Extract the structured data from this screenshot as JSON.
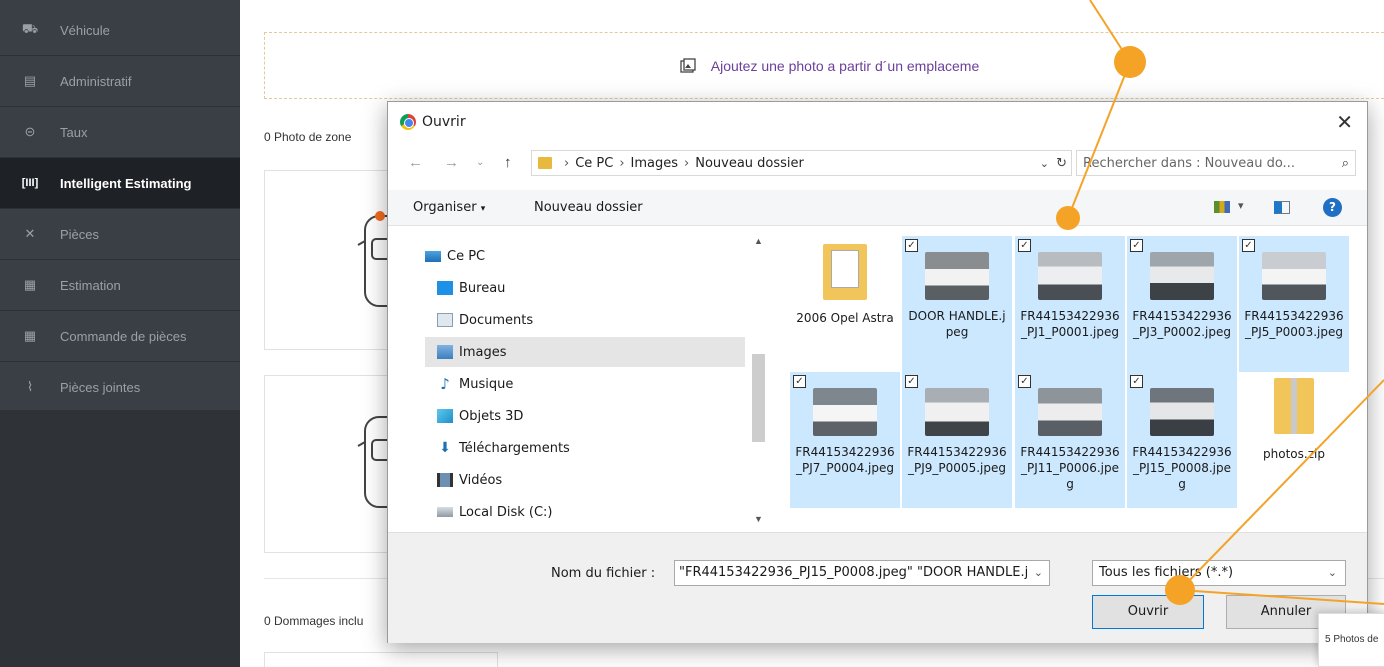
{
  "sidebar": {
    "items": [
      {
        "label": "Véhicule",
        "icon": "car-icon"
      },
      {
        "label": "Administratif",
        "icon": "document-icon"
      },
      {
        "label": "Taux",
        "icon": "tag-icon"
      },
      {
        "label": "Intelligent Estimating",
        "icon": "intelligent-icon",
        "active": true
      },
      {
        "label": "Pièces",
        "icon": "tools-icon"
      },
      {
        "label": "Estimation",
        "icon": "calculator-icon"
      },
      {
        "label": "Commande de pièces",
        "icon": "order-icon"
      },
      {
        "label": "Pièces jointes",
        "icon": "paperclip-icon"
      }
    ]
  },
  "main": {
    "upload_text": "Ajoutez une photo a partir d´un emplaceme",
    "zone_label": "0 Photo de zone",
    "damage_label": "0 Dommages inclu",
    "popup_text": "5 Photos de"
  },
  "dialog": {
    "title": "Ouvrir",
    "path": [
      "Ce PC",
      "Images",
      "Nouveau dossier"
    ],
    "search_placeholder": "Rechercher dans : Nouveau do...",
    "organize": "Organiser",
    "new_folder": "Nouveau dossier",
    "tree": [
      "Ce PC",
      "Bureau",
      "Documents",
      "Images",
      "Musique",
      "Objets 3D",
      "Téléchargements",
      "Vidéos",
      "Local Disk (C:)"
    ],
    "files": [
      {
        "name": "2006 Opel Astra",
        "selected": false
      },
      {
        "name": "DOOR HANDLE.jpeg",
        "selected": true
      },
      {
        "name": "FR44153422936_PJ1_P0001.jpeg",
        "selected": true
      },
      {
        "name": "FR44153422936_PJ3_P0002.jpeg",
        "selected": true
      },
      {
        "name": "FR44153422936_PJ5_P0003.jpeg",
        "selected": true
      },
      {
        "name": "FR44153422936_PJ7_P0004.jpeg",
        "selected": true
      },
      {
        "name": "FR44153422936_PJ9_P0005.jpeg",
        "selected": true
      },
      {
        "name": "FR44153422936_PJ11_P0006.jpeg",
        "selected": true
      },
      {
        "name": "FR44153422936_PJ15_P0008.jpeg",
        "selected": true
      },
      {
        "name": "photos.zip",
        "selected": false
      }
    ],
    "filename_label": "Nom du fichier :",
    "filename_value": "\"FR44153422936_PJ15_P0008.jpeg\" \"DOOR HANDLE.j",
    "filter": "Tous les fichiers (*.*)",
    "open_btn": "Ouvrir",
    "cancel_btn": "Annuler"
  },
  "colors": {
    "accent": "#f4a327",
    "sidebar": "#2f3338",
    "selection": "#cce8ff",
    "link_purple": "#6b3f9a"
  }
}
